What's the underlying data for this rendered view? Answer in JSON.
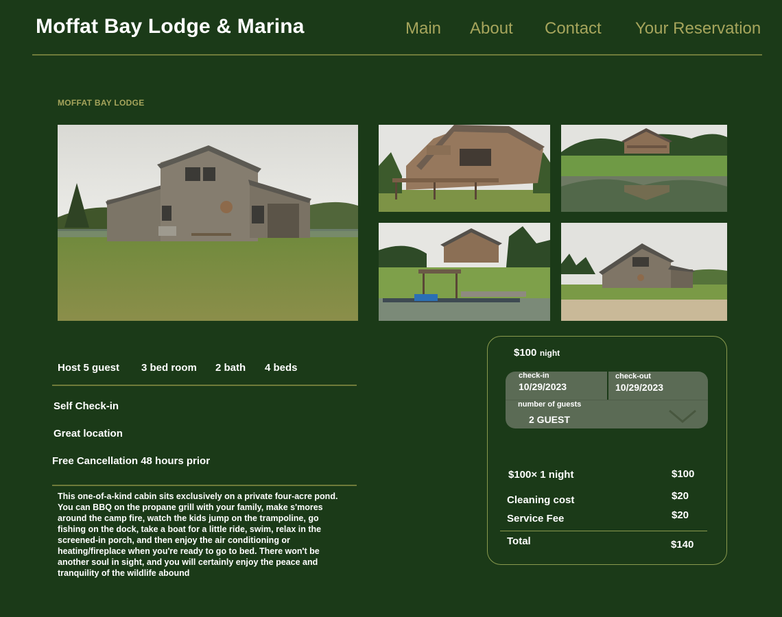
{
  "header": {
    "site_title": "Moffat Bay Lodge & Marina",
    "nav": [
      "Main",
      "About",
      "Contact",
      "Your Reservation"
    ]
  },
  "listing": {
    "eyebrow": "MOFFAT BAY LODGE",
    "facts": [
      "Host 5  guest",
      "3 bed room",
      "2 bath",
      "4 beds"
    ],
    "features": [
      "Self Check-in",
      "Great location",
      "Free Cancellation  48 hours prior"
    ],
    "description": "This one-of-a-kind cabin sits exclusively on a private four-acre pond.\n You can BBQ on the propane grill with your family, make s'mores\naround the camp fire, watch the kids jump on the trampoline, go\n fishing on the dock, take a boat for a little ride, swim, relax in the\nscreened-in porch, and then enjoy the air conditioning or\nheating/fireplace when you're ready to go to bed.  There won't be\n another soul in sight, and you will certainly enjoy the peace and\n tranquility of the wildlife abound"
  },
  "booking": {
    "price": "$100",
    "price_unit": "night",
    "checkin_label": "check-in",
    "checkin_value": "10/29/2023",
    "checkout_label": "check-out",
    "checkout_value": "10/29/2023",
    "guests_label": "number of guests",
    "guests_value": "2 GUEST",
    "guests_icon": "chevron-down-icon",
    "lines": [
      {
        "label": "$100× 1 night",
        "amount": "$100"
      },
      {
        "label": "Cleaning cost",
        "amount": "$20"
      },
      {
        "label": "Service Fee",
        "amount": "$20"
      }
    ],
    "total_label": "Total",
    "total_amount": "$140"
  },
  "colors": {
    "background": "#1b3a18",
    "accent": "#a6a55c",
    "rule": "#6f7b3a",
    "field": "#5b6b55"
  }
}
